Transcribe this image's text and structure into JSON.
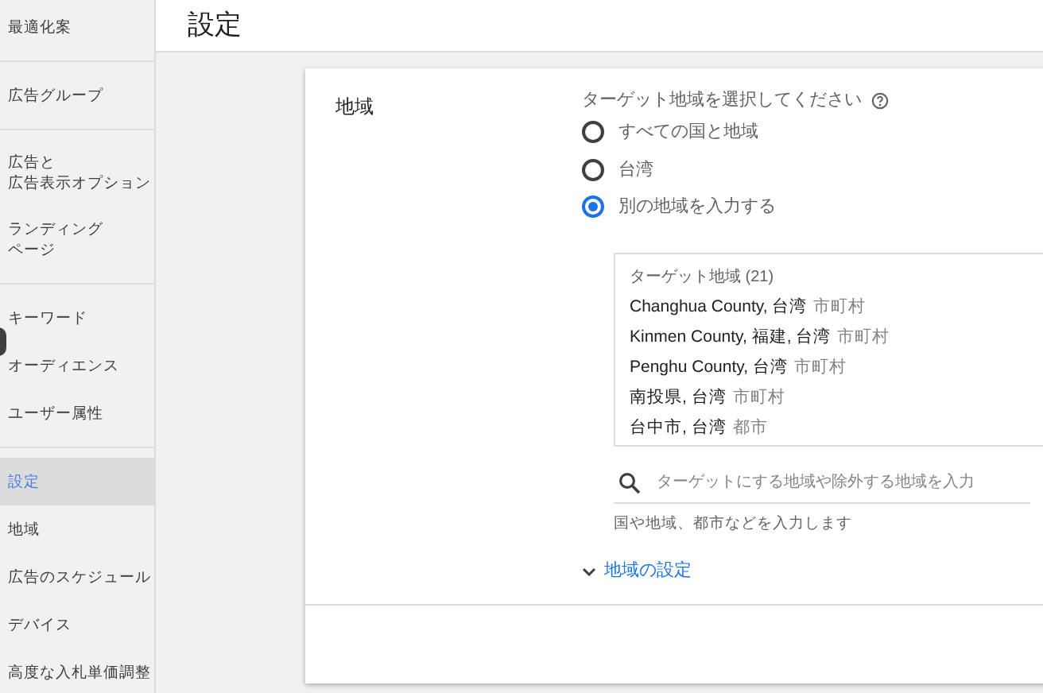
{
  "sidebar": {
    "groups": [
      [
        {
          "lines": [
            "最適化案"
          ],
          "selected": false
        }
      ],
      [
        {
          "lines": [
            "広告グループ"
          ],
          "selected": false
        }
      ],
      [
        {
          "lines": [
            "広告と",
            "広告表示オプション"
          ],
          "selected": false
        },
        {
          "lines": [
            "ランディング",
            "ページ"
          ],
          "selected": false
        }
      ],
      [
        {
          "lines": [
            "キーワード"
          ],
          "selected": false
        },
        {
          "lines": [
            "オーディエンス"
          ],
          "selected": false
        },
        {
          "lines": [
            "ユーザー属性"
          ],
          "selected": false
        }
      ],
      [
        {
          "lines": [
            "設定"
          ],
          "selected": true
        },
        {
          "lines": [
            "地域"
          ],
          "selected": false
        },
        {
          "lines": [
            "広告のスケジュール"
          ],
          "selected": false
        },
        {
          "lines": [
            "デバイス"
          ],
          "selected": false
        },
        {
          "lines": [
            "高度な入札単価調整"
          ],
          "selected": false
        }
      ]
    ]
  },
  "page_title": "設定",
  "section": {
    "label": "地域",
    "prompt": "ターゲット地域を選択してください",
    "options": [
      {
        "label": "すべての国と地域",
        "selected": false
      },
      {
        "label": "台湾",
        "selected": false
      },
      {
        "label": "別の地域を入力する",
        "selected": true
      }
    ],
    "targets": {
      "heading": "ターゲット地域 (21)",
      "rows": [
        {
          "name": "Changhua County, 台湾",
          "type": "市町村"
        },
        {
          "name": "Kinmen County, 福建, 台湾",
          "type": "市町村"
        },
        {
          "name": "Penghu County, 台湾",
          "type": "市町村"
        },
        {
          "name": "南投県, 台湾",
          "type": "市町村"
        },
        {
          "name": "台中市, 台湾",
          "type": "都市"
        }
      ]
    },
    "search": {
      "placeholder": "ターゲットにする地域や除外する地域を入力",
      "hint": "国や地域、都市などを入力します"
    },
    "expand_link": "地域の設定"
  }
}
